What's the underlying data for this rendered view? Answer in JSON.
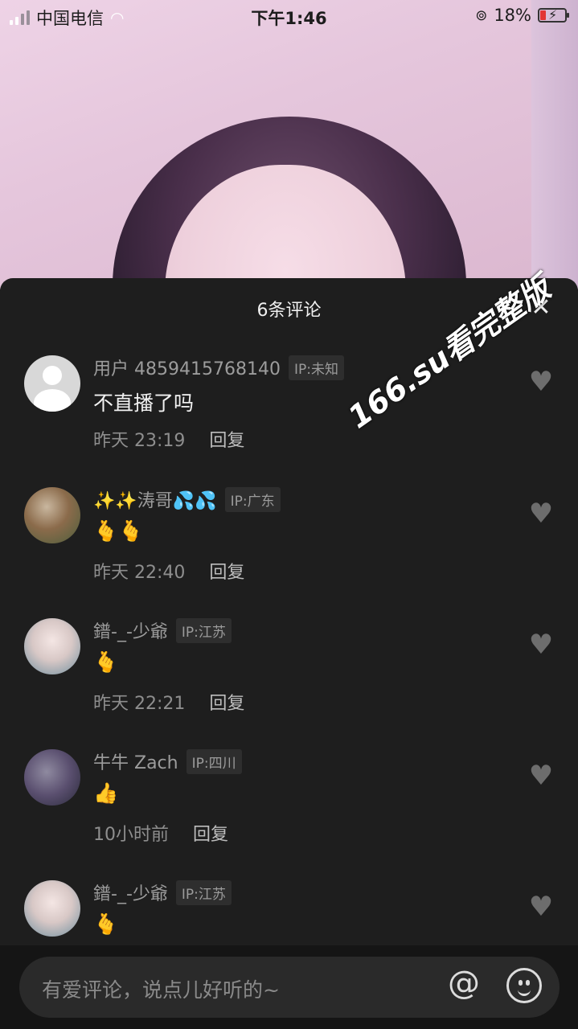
{
  "status_bar": {
    "carrier": "中国电信",
    "time": "下午1:46",
    "battery": "18%"
  },
  "sheet": {
    "title": "6条评论",
    "close_icon": "close-icon"
  },
  "watermark": "166.su看完整版",
  "comments": [
    {
      "username": "用户 4859415768140",
      "ip": "IP:未知",
      "text": "不直播了吗",
      "time": "昨天 23:19",
      "reply": "回复"
    },
    {
      "username": "✨✨涛哥💦💦",
      "ip": "IP:广东",
      "text": "🫰🫰",
      "time": "昨天 22:40",
      "reply": "回复"
    },
    {
      "username": "鐠-_-少爺",
      "ip": "IP:江苏",
      "text": "🫰",
      "time": "昨天 22:21",
      "reply": "回复"
    },
    {
      "username": "牛牛 Zach",
      "ip": "IP:四川",
      "text": "👍",
      "time": "10小时前",
      "reply": "回复"
    },
    {
      "username": "鐠-_-少爺",
      "ip": "IP:江苏",
      "text": "🫰",
      "time": "",
      "reply": ""
    }
  ],
  "input": {
    "placeholder": "有爱评论，说点儿好听的~"
  },
  "icons": {
    "at": "at-icon",
    "emoji": "emoji-icon",
    "heart": "heart-icon"
  }
}
